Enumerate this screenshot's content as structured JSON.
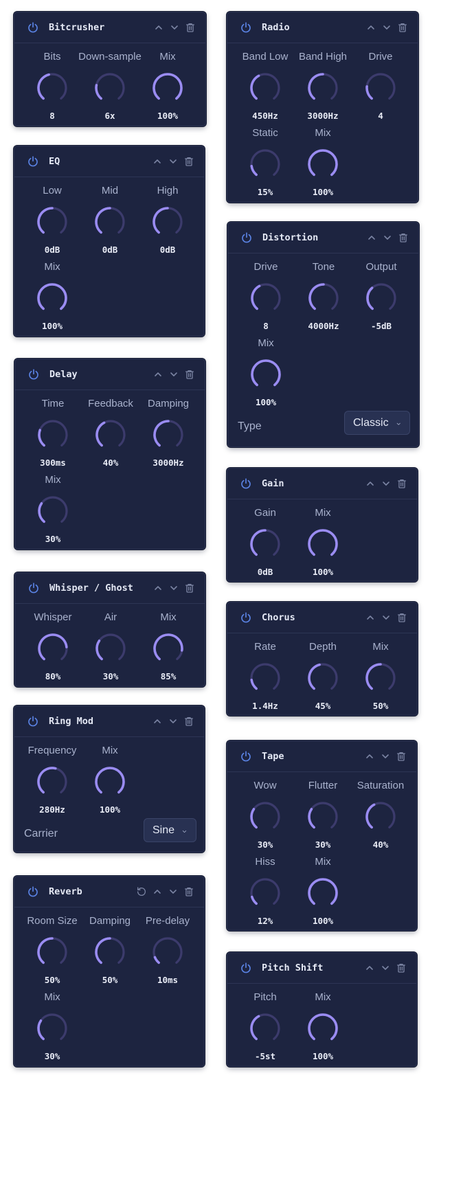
{
  "colors": {
    "panel_bg": "#1d2440",
    "knob_track": "#3c3b6c",
    "knob_fill": "#9a8cf2",
    "power_icon": "#5b84e6",
    "header_icons": "#7b84a3"
  },
  "icons": {
    "power": "power-icon",
    "up": "chevron-up-icon",
    "down": "chevron-down-icon",
    "delete": "trash-icon",
    "reset": "reset-icon"
  },
  "panels": [
    {
      "id": "bitcrusher",
      "title": "Bitcrusher",
      "knobs": [
        {
          "label": "Bits",
          "value": "8",
          "level": 0.45
        },
        {
          "label": "Down-sample",
          "value": "6x",
          "level": 0.22
        },
        {
          "label": "Mix",
          "value": "100%",
          "level": 1.0
        }
      ]
    },
    {
      "id": "eq",
      "title": "EQ",
      "knobs": [
        {
          "label": "Low",
          "value": "0dB",
          "level": 0.5
        },
        {
          "label": "Mid",
          "value": "0dB",
          "level": 0.5
        },
        {
          "label": "High",
          "value": "0dB",
          "level": 0.5
        },
        {
          "label": "Mix",
          "value": "100%",
          "level": 1.0
        }
      ]
    },
    {
      "id": "delay",
      "title": "Delay",
      "knobs": [
        {
          "label": "Time",
          "value": "300ms",
          "level": 0.25
        },
        {
          "label": "Feedback",
          "value": "40%",
          "level": 0.4
        },
        {
          "label": "Damping",
          "value": "3000Hz",
          "level": 0.5
        },
        {
          "label": "Mix",
          "value": "30%",
          "level": 0.3
        }
      ]
    },
    {
      "id": "whisper",
      "title": "Whisper / Ghost",
      "knobs": [
        {
          "label": "Whisper",
          "value": "80%",
          "level": 0.8
        },
        {
          "label": "Air",
          "value": "30%",
          "level": 0.3
        },
        {
          "label": "Mix",
          "value": "85%",
          "level": 0.85
        }
      ]
    },
    {
      "id": "ringmod",
      "title": "Ring Mod",
      "knobs": [
        {
          "label": "Frequency",
          "value": "280Hz",
          "level": 0.55
        },
        {
          "label": "Mix",
          "value": "100%",
          "level": 1.0
        }
      ],
      "select": {
        "label": "Carrier",
        "value": "Sine"
      }
    },
    {
      "id": "reverb",
      "title": "Reverb",
      "reset": true,
      "knobs": [
        {
          "label": "Room Size",
          "value": "50%",
          "level": 0.5
        },
        {
          "label": "Damping",
          "value": "50%",
          "level": 0.5
        },
        {
          "label": "Pre-delay",
          "value": "10ms",
          "level": 0.1
        },
        {
          "label": "Mix",
          "value": "30%",
          "level": 0.3
        }
      ]
    },
    {
      "id": "radio",
      "title": "Radio",
      "knobs": [
        {
          "label": "Band Low",
          "value": "450Hz",
          "level": 0.4
        },
        {
          "label": "Band High",
          "value": "3000Hz",
          "level": 0.5
        },
        {
          "label": "Drive",
          "value": "4",
          "level": 0.2
        },
        {
          "label": "Static",
          "value": "15%",
          "level": 0.15
        },
        {
          "label": "Mix",
          "value": "100%",
          "level": 1.0
        }
      ]
    },
    {
      "id": "distortion",
      "title": "Distortion",
      "knobs": [
        {
          "label": "Drive",
          "value": "8",
          "level": 0.4
        },
        {
          "label": "Tone",
          "value": "4000Hz",
          "level": 0.5
        },
        {
          "label": "Output",
          "value": "-5dB",
          "level": 0.35
        },
        {
          "label": "Mix",
          "value": "100%",
          "level": 1.0
        }
      ],
      "select": {
        "label": "Type",
        "value": "Classic"
      }
    },
    {
      "id": "gain",
      "title": "Gain",
      "knobs": [
        {
          "label": "Gain",
          "value": "0dB",
          "level": 0.5
        },
        {
          "label": "Mix",
          "value": "100%",
          "level": 1.0
        }
      ]
    },
    {
      "id": "chorus",
      "title": "Chorus",
      "knobs": [
        {
          "label": "Rate",
          "value": "1.4Hz",
          "level": 0.15
        },
        {
          "label": "Depth",
          "value": "45%",
          "level": 0.45
        },
        {
          "label": "Mix",
          "value": "50%",
          "level": 0.5
        }
      ]
    },
    {
      "id": "tape",
      "title": "Tape",
      "knobs": [
        {
          "label": "Wow",
          "value": "30%",
          "level": 0.3
        },
        {
          "label": "Flutter",
          "value": "30%",
          "level": 0.3
        },
        {
          "label": "Saturation",
          "value": "40%",
          "level": 0.4
        },
        {
          "label": "Hiss",
          "value": "12%",
          "level": 0.12
        },
        {
          "label": "Mix",
          "value": "100%",
          "level": 1.0
        }
      ]
    },
    {
      "id": "pitch",
      "title": "Pitch Shift",
      "knobs": [
        {
          "label": "Pitch",
          "value": "-5st",
          "level": 0.4
        },
        {
          "label": "Mix",
          "value": "100%",
          "level": 1.0
        }
      ]
    }
  ]
}
